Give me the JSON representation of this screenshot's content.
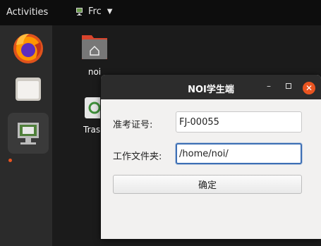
{
  "topbar": {
    "activities_label": "Activities",
    "app_menu_label": "Frc"
  },
  "dock": {
    "items": [
      {
        "name": "Firefox",
        "icon": "firefox-icon"
      },
      {
        "name": "Files",
        "icon": "files-icon"
      },
      {
        "name": "NOI",
        "icon": "noi-client-icon",
        "running": true
      }
    ]
  },
  "desktop": {
    "icons": [
      {
        "label": "noi",
        "icon": "home-folder-icon"
      },
      {
        "label": "Tras",
        "icon": "trash-icon"
      }
    ]
  },
  "dialog": {
    "title": "NOI学生端",
    "ticket_label": "准考证号:",
    "ticket_value": "FJ-00055",
    "workdir_label": "工作文件夹:",
    "workdir_value": "/home/noi/",
    "confirm_label": "确定"
  },
  "colors": {
    "accent": "#e95420",
    "focus": "#3d6fb5",
    "topbar_bg": "#0d0d0d",
    "dock_bg": "#2b2b2b"
  }
}
